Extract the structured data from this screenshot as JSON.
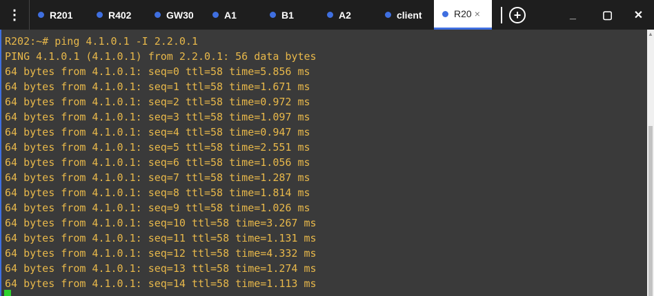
{
  "tabs": [
    {
      "label": "R201"
    },
    {
      "label": "R402"
    },
    {
      "label": "GW30"
    },
    {
      "label": "A1"
    },
    {
      "label": "B1"
    },
    {
      "label": "A2"
    },
    {
      "label": "client"
    },
    {
      "label": "R20",
      "active": true
    }
  ],
  "icons": {
    "menu": "vertical-dots-icon",
    "tab_dot": "status-dot-icon",
    "close": "close-icon",
    "add": "add-tab-icon",
    "minimize": "minimize-icon",
    "maximize": "maximize-icon",
    "window_close": "window-close-icon"
  },
  "glyphs": {
    "menu": "⋮",
    "close": "×",
    "add": "+",
    "minimize": "_",
    "maximize": "▢",
    "window_close": "✕"
  },
  "colors": {
    "tab_dot": "#3f6fe0",
    "terminal_text": "#e8b84a",
    "terminal_bg": "#3a3a3a",
    "cursor": "#2ed12e"
  },
  "terminal": {
    "lines": [
      "R202:~# ping 4.1.0.1 -I 2.2.0.1",
      "PING 4.1.0.1 (4.1.0.1) from 2.2.0.1: 56 data bytes",
      "64 bytes from 4.1.0.1: seq=0 ttl=58 time=5.856 ms",
      "64 bytes from 4.1.0.1: seq=1 ttl=58 time=1.671 ms",
      "64 bytes from 4.1.0.1: seq=2 ttl=58 time=0.972 ms",
      "64 bytes from 4.1.0.1: seq=3 ttl=58 time=1.097 ms",
      "64 bytes from 4.1.0.1: seq=4 ttl=58 time=0.947 ms",
      "64 bytes from 4.1.0.1: seq=5 ttl=58 time=2.551 ms",
      "64 bytes from 4.1.0.1: seq=6 ttl=58 time=1.056 ms",
      "64 bytes from 4.1.0.1: seq=7 ttl=58 time=1.287 ms",
      "64 bytes from 4.1.0.1: seq=8 ttl=58 time=1.814 ms",
      "64 bytes from 4.1.0.1: seq=9 ttl=58 time=1.026 ms",
      "64 bytes from 4.1.0.1: seq=10 ttl=58 time=3.267 ms",
      "64 bytes from 4.1.0.1: seq=11 ttl=58 time=1.131 ms",
      "64 bytes from 4.1.0.1: seq=12 ttl=58 time=4.332 ms",
      "64 bytes from 4.1.0.1: seq=13 ttl=58 time=1.274 ms",
      "64 bytes from 4.1.0.1: seq=14 ttl=58 time=1.113 ms"
    ]
  }
}
